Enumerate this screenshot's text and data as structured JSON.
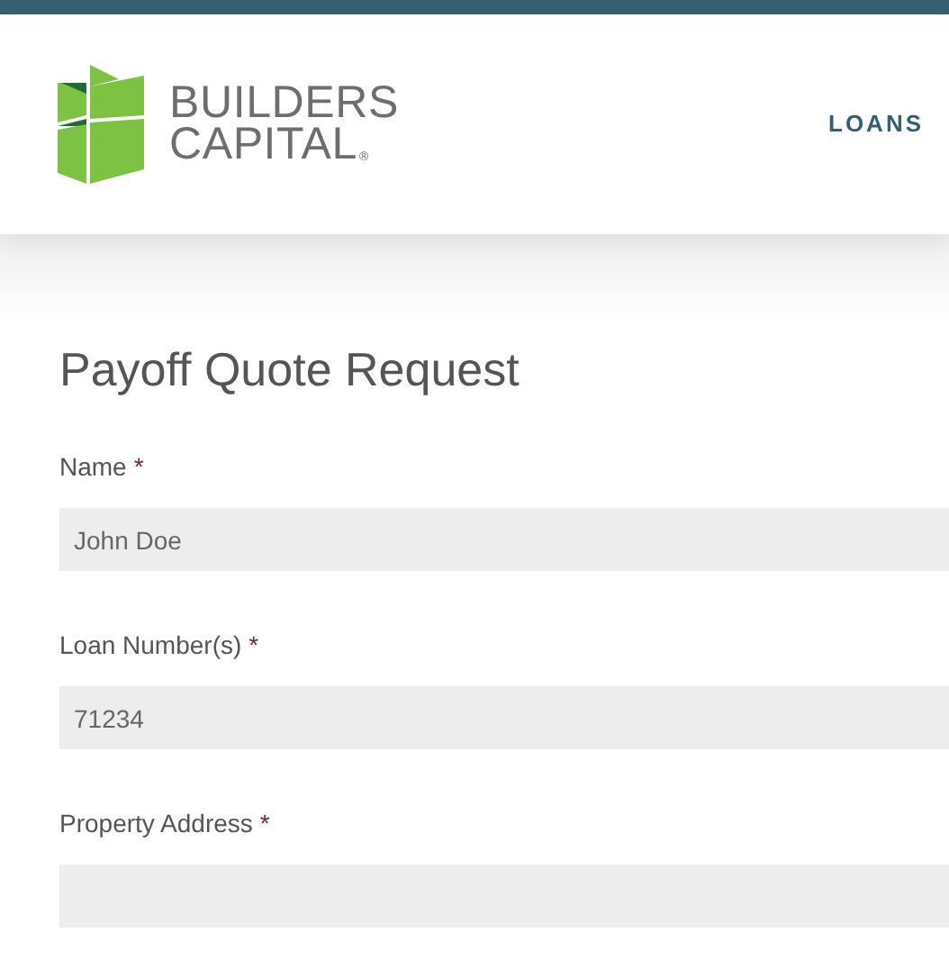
{
  "header": {
    "logo": {
      "line_1": "BUILDERS",
      "line_2": "CAPITAL",
      "mark": "®"
    },
    "nav": [
      {
        "label": "LOANS"
      }
    ]
  },
  "form": {
    "title": "Payoff Quote Request",
    "fields": [
      {
        "label": "Name",
        "required_mark": "*",
        "value": "John Doe"
      },
      {
        "label": "Loan Number(s)",
        "required_mark": "*",
        "value": "71234"
      },
      {
        "label": "Property Address",
        "required_mark": "*"
      }
    ]
  }
}
